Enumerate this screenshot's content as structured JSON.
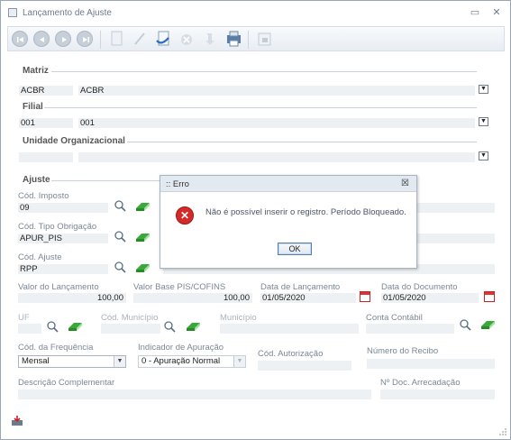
{
  "window": {
    "title": "Lançamento de Ajuste",
    "restore_glyph": "▭",
    "close_glyph": "✕"
  },
  "sections": {
    "matriz": "Matriz",
    "filial": "Filial",
    "unidade": "Unidade Organizacional",
    "ajuste": "Ajuste"
  },
  "matriz": {
    "code": "ACBR",
    "name": "ACBR"
  },
  "filial": {
    "code": "001",
    "name": "001"
  },
  "unidade": {
    "code": "",
    "name": ""
  },
  "fields": {
    "cod_imposto": {
      "label": "Cód. Imposto",
      "value": "09"
    },
    "cod_tipo_obrigacao": {
      "label": "Cód. Tipo Obrigação",
      "value": "APUR_PIS"
    },
    "cod_ajuste": {
      "label": "Cód. Ajuste",
      "value": "RPP"
    },
    "cod_ajuste_desc_partial": "...",
    "valor_lancamento": {
      "label": "Valor do Lançamento",
      "value": "100,00"
    },
    "valor_base": {
      "label": "Valor Base PIS/COFINS",
      "value": "100,00"
    },
    "data_lancamento": {
      "label": "Data de Lançamento",
      "value": "01/05/2020"
    },
    "data_documento": {
      "label": "Data do Documento",
      "value": "01/05/2020"
    },
    "uf": {
      "label": "UF",
      "value": ""
    },
    "cod_municipio": {
      "label": "Cód. Município",
      "value": ""
    },
    "municipio": {
      "label": "Município",
      "value": ""
    },
    "conta_contabil": {
      "label": "Conta Contábil",
      "value": ""
    },
    "cod_frequencia": {
      "label": "Cód. da Frequência",
      "value": "Mensal"
    },
    "indicador_apuracao": {
      "label": "Indicador de Apuração",
      "value": "0 - Apuração Normal"
    },
    "cod_autorizacao": {
      "label": "Cód. Autorização",
      "value": ""
    },
    "numero_recibo": {
      "label": "Número do Recibo",
      "value": ""
    },
    "descricao_complementar": {
      "label": "Descrição Complementar",
      "value": ""
    },
    "n_doc_arrecadacao": {
      "label": "Nº Doc. Arrecadação",
      "value": ""
    }
  },
  "dialog": {
    "title": ":: Erro",
    "close_glyph": "☒",
    "icon_glyph": "✕",
    "message": "Não é possível inserir o registro. Período Bloqueado.",
    "ok_label": "OK"
  },
  "colors": {
    "accent": "#4f7fb5",
    "error": "#d42a2a",
    "eraser_green": "#3aa83a"
  }
}
